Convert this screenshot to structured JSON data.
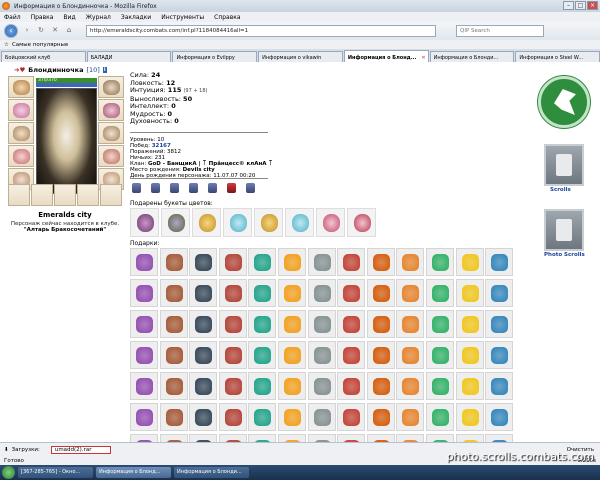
{
  "window": {
    "title": "Информация о Блондинночка - Mozilla Firefox"
  },
  "menu": [
    "Файл",
    "Правка",
    "Вид",
    "Журнал",
    "Закладки",
    "Инструменты",
    "Справка"
  ],
  "nav": {
    "url": "http://emeraldscity.combats.com/inf.pl?1184084416all=1",
    "search_placeholder": "QIP Search"
  },
  "bookmarks": {
    "label": "Самые популярные"
  },
  "tabs": [
    {
      "label": "Бойцовский клуб"
    },
    {
      "label": "БАЛАДИ"
    },
    {
      "label": "Информация о Evilppy"
    },
    {
      "label": "Информация о vikawin"
    },
    {
      "label": "Информация о Блонд...",
      "active": true
    },
    {
      "label": "Информация о Блонди..."
    },
    {
      "label": "Информация о Steel W..."
    }
  ],
  "character": {
    "name": "Блондинночка",
    "level": "[10]",
    "badge": "i",
    "hp": "370/370",
    "city": "Emeralds city",
    "location_text": "Персонаж сейчас находится в клубе.",
    "location_name": "\"Алтарь Бракосочетаний\""
  },
  "stats": {
    "strength": {
      "label": "Сила:",
      "value": "24"
    },
    "agility": {
      "label": "Ловкость:",
      "value": "12"
    },
    "intuition": {
      "label": "Интуиция:",
      "value": "115",
      "bonus": "(97 + 18)"
    },
    "endurance": {
      "label": "Выносливость:",
      "value": "50"
    },
    "intellect": {
      "label": "Интеллект:",
      "value": "0"
    },
    "wisdom": {
      "label": "Мудрость:",
      "value": "0"
    },
    "spirit": {
      "label": "Духовность:",
      "value": "0"
    }
  },
  "info": {
    "levels": "Уровень: 10",
    "wins_label": "Побед:",
    "wins": "32167",
    "losses": "Поражений: 3812",
    "draws": "Ничьих: 231",
    "clan_label": "Клан:",
    "clan": "GoD - БанщикА | ꓄ Прâнцесс© клАнА ꓄",
    "birthplace_label": "Место рождения:",
    "birthplace": "Devils city",
    "birthday": "День рождения персонажа: 11.07.07 00:20"
  },
  "sections": {
    "flowers_label": "Подарены букеты цветов:",
    "gifts_label": "Подарки:"
  },
  "right_panel": {
    "scrolls_label": "Scrolls",
    "photo_scrolls_label": "Photo Scrolls"
  },
  "status": {
    "downloads_label": "Загрузки:",
    "download_file": "umadd(2).rar",
    "clear_label": "Очистить",
    "ready": "Готово",
    "time": "0.210s"
  },
  "taskbar": [
    "[367-285-765] - Окно...",
    "Информация о Блонд...",
    "Информация о Блонди..."
  ],
  "watermark": "photo.scrolls.combats.com",
  "colors": {
    "accent_green": "#2f8d3e",
    "link_blue": "#1b3f9a",
    "hp_green": "#3a8f2a"
  }
}
